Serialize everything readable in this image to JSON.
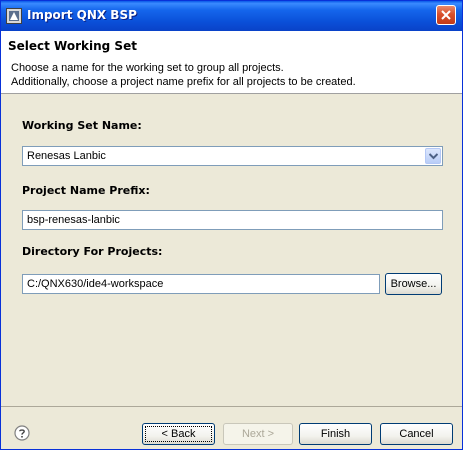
{
  "window": {
    "title": "Import QNX BSP",
    "close_label": "close"
  },
  "banner": {
    "title": "Select Working Set",
    "description_line1": "Choose a name for the working set to group all projects.",
    "description_line2": "Additionally, choose a project name prefix for all projects to be created."
  },
  "form": {
    "working_set_label": "Working Set Name:",
    "working_set_value": "Renesas Lanbic",
    "prefix_label": "Project Name Prefix:",
    "prefix_value": "bsp-renesas-lanbic",
    "directory_label": "Directory For Projects:",
    "directory_value": "C:/QNX630/ide4-workspace",
    "browse_label": "Browse..."
  },
  "footer": {
    "back_label": "< Back",
    "next_label": "Next >",
    "finish_label": "Finish",
    "cancel_label": "Cancel"
  },
  "icons": {
    "app": "qnx-app-icon",
    "close": "close-icon",
    "dropdown": "chevron-down-icon",
    "help": "help-icon"
  },
  "colors": {
    "titlebar": "#0a4fd8",
    "dialog_bg": "#ece9d8",
    "field_border": "#7f9db9",
    "close_button": "#d9502c"
  }
}
